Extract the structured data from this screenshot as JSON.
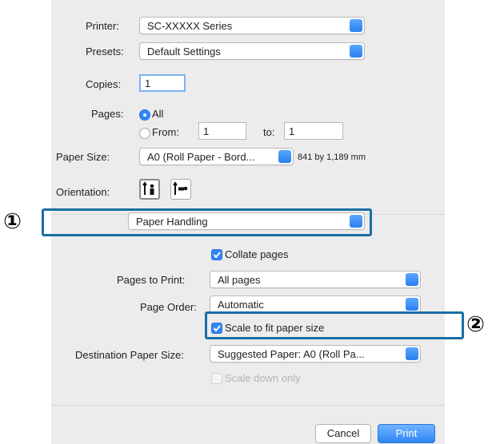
{
  "printer": {
    "label": "Printer:",
    "value": "SC-XXXXX Series"
  },
  "presets": {
    "label": "Presets:",
    "value": "Default Settings"
  },
  "copies": {
    "label": "Copies:",
    "value": "1"
  },
  "pages": {
    "label": "Pages:",
    "all_label": "All",
    "from_label": "From:",
    "from_value": "1",
    "to_label": "to:",
    "to_value": "1"
  },
  "paper_size": {
    "label": "Paper Size:",
    "value": "A0 (Roll Paper - Bord...",
    "dimensions": "841 by 1,189 mm"
  },
  "orientation": {
    "label": "Orientation:"
  },
  "panel": {
    "value": "Paper Handling"
  },
  "collate": {
    "label": "Collate pages",
    "checked": true
  },
  "pages_to_print": {
    "label": "Pages to Print:",
    "value": "All pages"
  },
  "page_order": {
    "label": "Page Order:",
    "value": "Automatic"
  },
  "scale_to_fit": {
    "label": "Scale to fit paper size",
    "checked": true
  },
  "destination": {
    "label": "Destination Paper Size:",
    "value": "Suggested Paper: A0 (Roll Pa..."
  },
  "scale_down": {
    "label": "Scale down only",
    "checked": false,
    "enabled": false
  },
  "buttons": {
    "cancel": "Cancel",
    "print": "Print"
  },
  "callouts": {
    "one": "①",
    "two": "②"
  },
  "colors": {
    "accent": "#2f86f6",
    "highlight": "#1a6ea5",
    "dialog_bg": "#ececec"
  }
}
